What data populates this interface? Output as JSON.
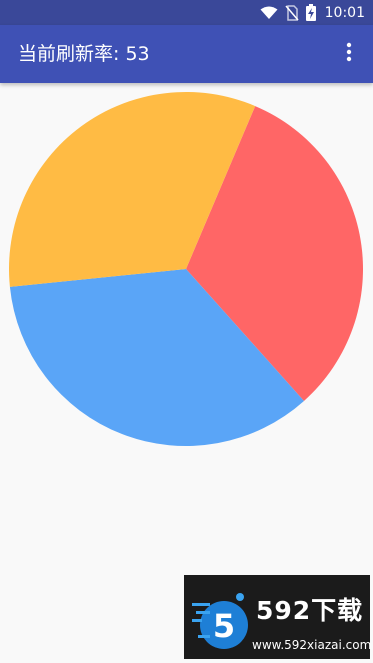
{
  "status_bar": {
    "time": "10:01",
    "icons": [
      "wifi-icon",
      "no-sim-icon",
      "battery-charging-icon"
    ]
  },
  "app_bar": {
    "title": "当前刷新率: 53",
    "menu_icon": "more-vert-icon"
  },
  "chart_data": {
    "type": "pie",
    "slices": [
      {
        "value": 32,
        "color": "#ff6666"
      },
      {
        "value": 35,
        "color": "#5aa5f7"
      },
      {
        "value": 33,
        "color": "#ffbb44"
      }
    ]
  },
  "watermark": {
    "brand": "592下载",
    "url": "www.592xiazai.com",
    "logo_digit": "5"
  },
  "colors": {
    "status_bar": "#3a4899",
    "app_bar": "#3f51b5",
    "background": "#f9f9f9"
  }
}
